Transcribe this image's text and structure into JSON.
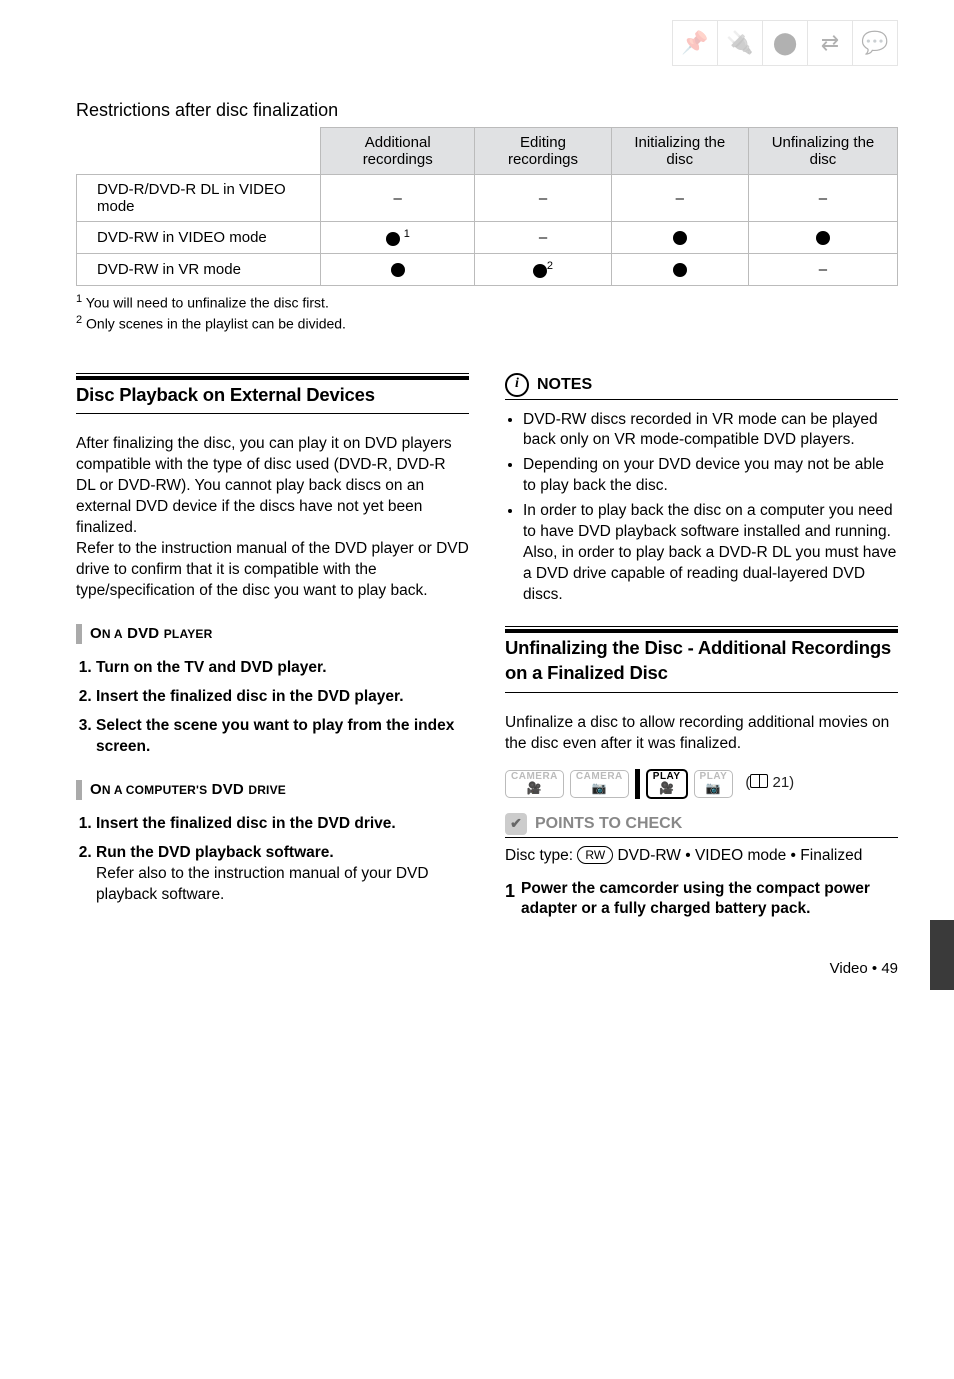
{
  "restrictions": {
    "title": "Restrictions after disc finalization",
    "headers": [
      "Additional recordings",
      "Editing recordings",
      "Initializing the disc",
      "Unfinalizing the disc"
    ],
    "rows": [
      {
        "label": "DVD-R/DVD-R DL in VIDEO mode",
        "cells": [
          "–",
          "–",
          "–",
          "–"
        ]
      },
      {
        "label": "DVD-RW in VIDEO mode",
        "cells": [
          "●1",
          "–",
          "●",
          "●"
        ]
      },
      {
        "label": "DVD-RW in VR mode",
        "cells": [
          "●",
          "●2",
          "●",
          "–"
        ]
      }
    ],
    "footnote1": "You will need to unfinalize the disc first.",
    "footnote2": "Only scenes in the playlist can be divided."
  },
  "left": {
    "heading": "Disc Playback on External Devices",
    "para": "After finalizing the disc, you can play it on DVD players compatible with the type of disc used (DVD-R, DVD-R DL or DVD-RW). You cannot play back discs on an external DVD device if the discs have not yet been finalized.\nRefer to the instruction manual of the DVD player or DVD drive to confirm that it is compatible with the type/specification of the disc you want to play back.",
    "sub1": "ON A DVD PLAYER",
    "steps1": [
      "Turn on the TV and DVD player.",
      "Insert the finalized disc in the DVD player.",
      "Select the scene you want to play from the index screen."
    ],
    "sub2": "ON A COMPUTER'S DVD DRIVE",
    "steps2": [
      {
        "main": "Insert the finalized disc in the DVD drive.",
        "sub": ""
      },
      {
        "main": "Run the DVD playback software.",
        "sub": "Refer also to the instruction manual of your DVD playback software."
      }
    ]
  },
  "right": {
    "notes_label": "NOTES",
    "notes": [
      "DVD-RW discs recorded in VR mode can be played back only on VR mode-compatible DVD players.",
      "Depending on your DVD device you may not be able to play back the disc.",
      "In order to play back the disc on a computer you need to have DVD playback software installed and running. Also, in order to play back a DVD-R DL you must have a DVD drive capable of reading dual-layered DVD discs."
    ],
    "heading": "Unfinalizing the Disc - Additional Recordings on a Finalized Disc",
    "para": "Unfinalize a disc to allow recording additional movies on the disc even after it was finalized.",
    "modes": [
      "CAMERA",
      "CAMERA",
      "PLAY",
      "PLAY"
    ],
    "page_ref": "21",
    "points_label": "POINTS TO CHECK",
    "disc_type_label": "Disc type:",
    "disc_type_value": "DVD-RW • VIDEO mode • Finalized",
    "rw_badge": "RW",
    "step_num": "1",
    "step_text": "Power the camcorder using the compact power adapter or a fully charged battery pack."
  },
  "footer": {
    "section": "Video",
    "page": "49"
  }
}
